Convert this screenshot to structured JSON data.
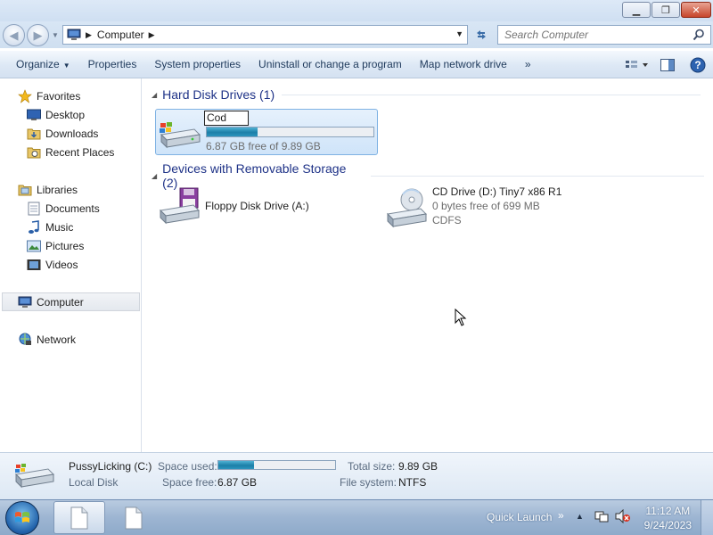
{
  "window": {
    "min_icon": "minimize-icon",
    "max_icon": "restore-icon",
    "close_icon": "close-icon"
  },
  "address": {
    "back_icon": "back-arrow-icon",
    "forward_icon": "forward-arrow-icon",
    "crumb": "Computer",
    "search_placeholder": "Search Computer"
  },
  "toolbar": {
    "organize": "Organize",
    "properties": "Properties",
    "system_properties": "System properties",
    "uninstall": "Uninstall or change a program",
    "map_drive": "Map network drive",
    "more": "»"
  },
  "nav": {
    "favorites": "Favorites",
    "desktop": "Desktop",
    "downloads": "Downloads",
    "recent_places": "Recent Places",
    "libraries": "Libraries",
    "documents": "Documents",
    "music": "Music",
    "pictures": "Pictures",
    "videos": "Videos",
    "computer": "Computer",
    "network": "Network"
  },
  "content": {
    "hdd_group": "Hard Disk Drives (1)",
    "removable_group": "Devices with Removable Storage (2)",
    "drive_c": {
      "rename_value": "Cod",
      "free_text": "6.87 GB free of 9.89 GB",
      "used_fraction": 0.305
    },
    "floppy": {
      "label": "Floppy Disk Drive (A:)"
    },
    "cd": {
      "label": "CD Drive (D:) Tiny7 x86 R1",
      "free_text": "0 bytes free of 699 MB",
      "fs": "CDFS"
    }
  },
  "details": {
    "name": "PussyLicking (C:)",
    "type": "Local Disk",
    "space_used_label": "Space used:",
    "space_free_label": "Space free:",
    "space_free": "6.87 GB",
    "total_size_label": "Total size:",
    "total_size": "9.89 GB",
    "fs_label": "File system:",
    "fs": "NTFS",
    "used_fraction": 0.305
  },
  "taskbar": {
    "quick_launch": "Quick Launch",
    "time": "11:12 AM",
    "date": "9/24/2023"
  },
  "colors": {
    "group_header": "#1e3287",
    "bar_fill": "#1c7fa8",
    "selection": "#cfe4f9"
  }
}
